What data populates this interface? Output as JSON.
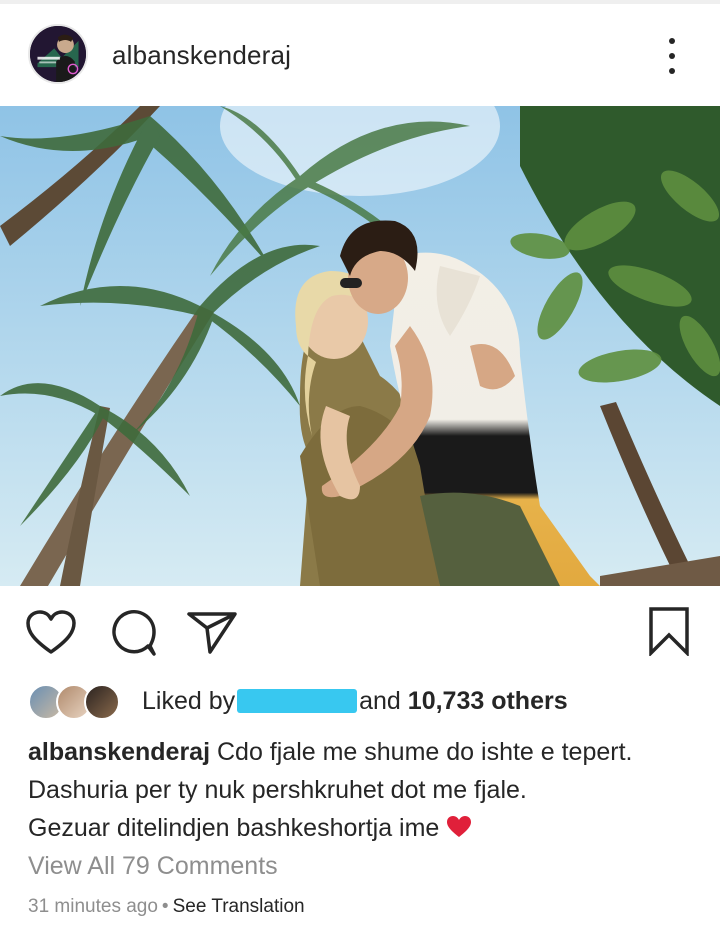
{
  "post": {
    "username": "albanskenderaj",
    "caption_username": "albanskenderaj",
    "caption_lines": [
      "Cdo fjale me shume do ishte e tepert.",
      "Dashuria per ty nuk pershkruhet dot me fjale.",
      "Gezuar ditelindjen bashkeshortja ime"
    ],
    "liked_prefix": "Liked by",
    "liked_suffix": "and",
    "likes_count": "10,733 others",
    "view_comments": "View All 79 Comments",
    "timestamp": "31 minutes ago",
    "separator": "•",
    "see_translation": "See Translation"
  },
  "icons": {
    "more": "more-options-icon",
    "like": "heart-outline-icon",
    "comment": "comment-bubble-icon",
    "share": "paper-plane-icon",
    "save": "bookmark-icon",
    "caption_emoji": "red-heart-icon"
  },
  "colors": {
    "text": "#262626",
    "muted": "#8e8e8e",
    "redaction": "#38c8f0",
    "heart": "#e0203a"
  }
}
